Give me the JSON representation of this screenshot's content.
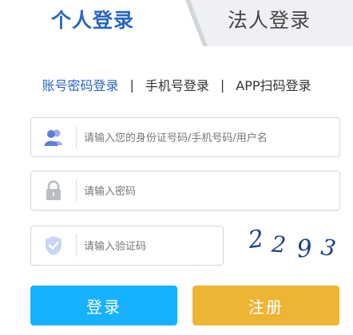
{
  "tabs": {
    "personal": "个人登录",
    "legal": "法人登录"
  },
  "login_methods": {
    "account": "账号密码登录",
    "separator": "|",
    "phone": "手机号登录",
    "app": "APP扫码登录"
  },
  "fields": {
    "username_placeholder": "请输入您的身份证号码/手机号码/用户名",
    "password_placeholder": "请输入密码",
    "captcha_placeholder": "请输入验证码"
  },
  "captcha": {
    "chars": [
      "2",
      "2",
      "9",
      "3"
    ],
    "color": "#1a3f8f"
  },
  "buttons": {
    "login": "登录",
    "register": "注册"
  },
  "colors": {
    "accent_blue": "#2a64c7",
    "login_button": "#16b2ff",
    "register_button": "#edb534",
    "icon_blue": "#5b7fd6"
  }
}
